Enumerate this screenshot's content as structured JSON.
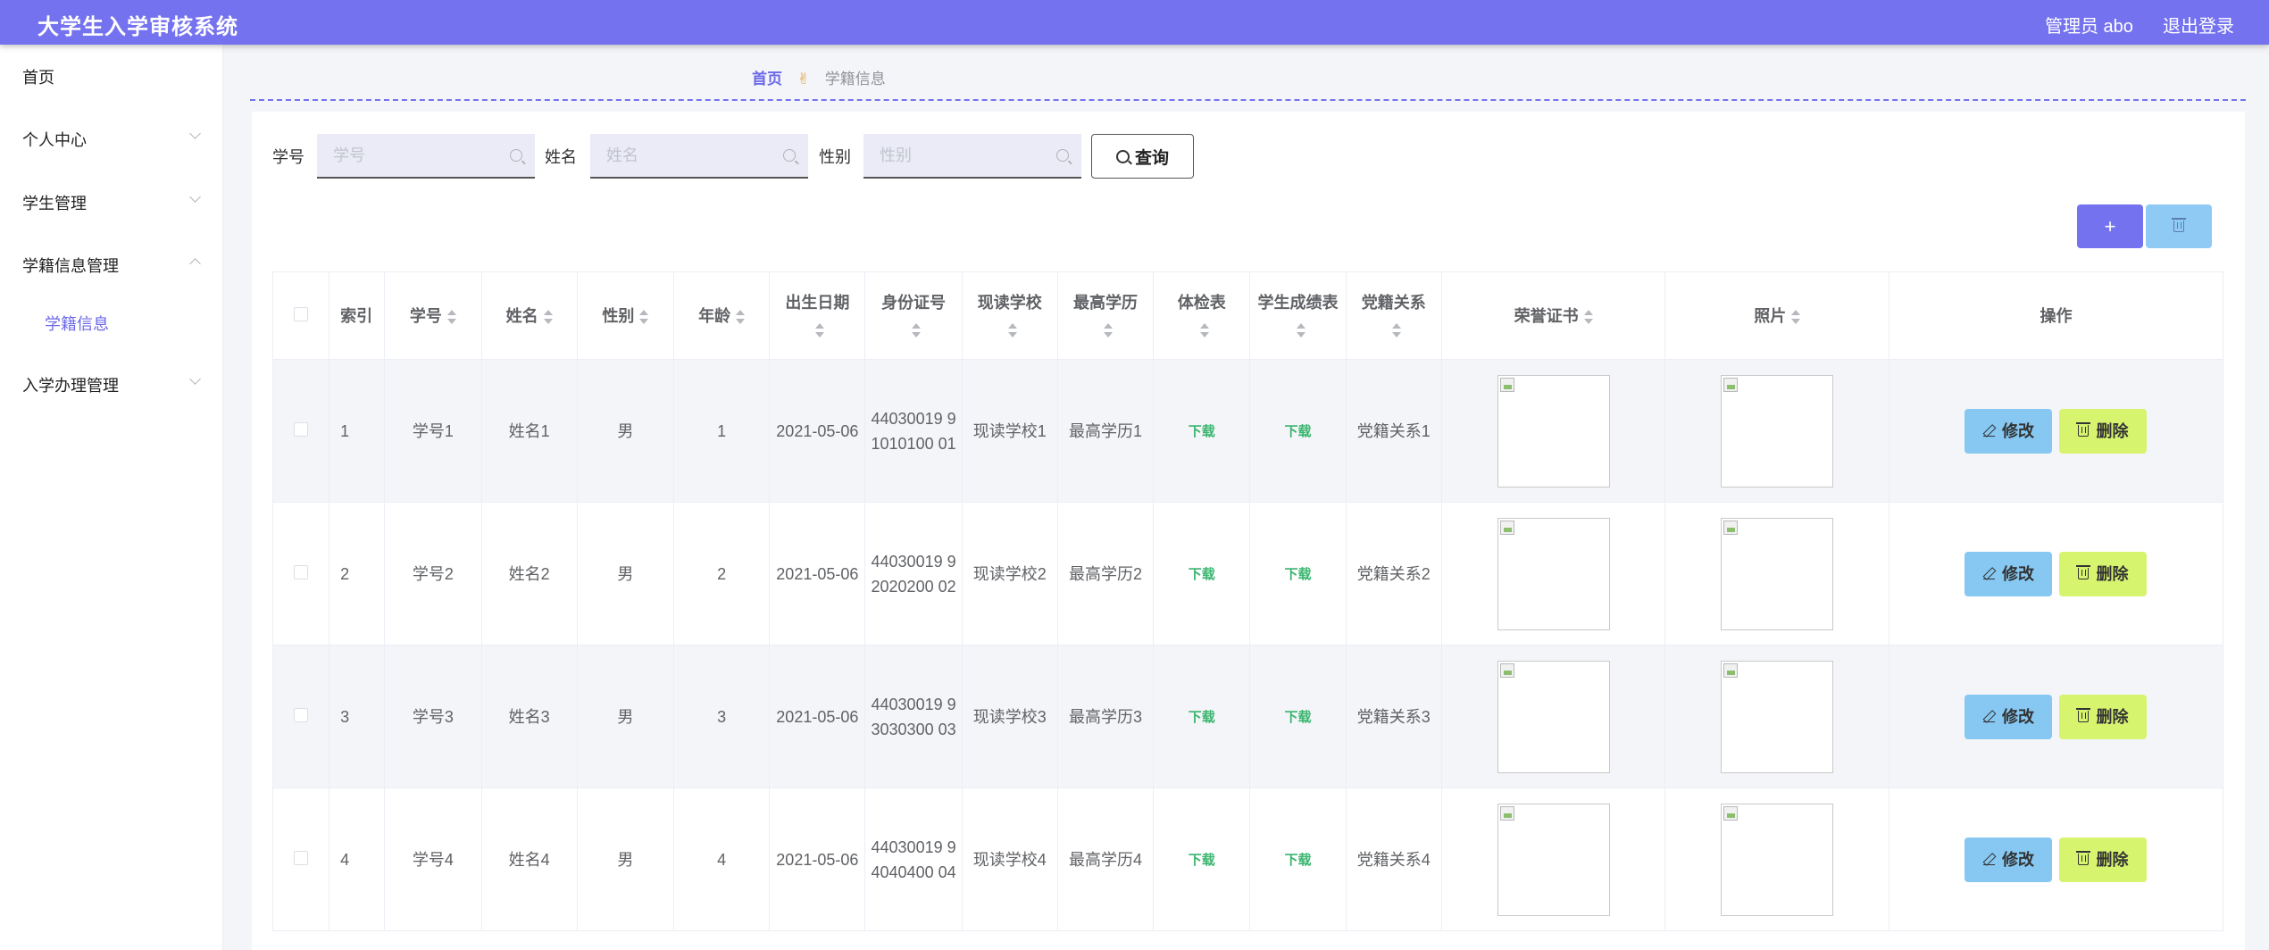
{
  "app": {
    "title": "大学生入学审核系统",
    "user": "管理员 abo",
    "logout": "退出登录"
  },
  "sidebar": {
    "items": [
      {
        "label": "首页"
      },
      {
        "label": "个人中心"
      },
      {
        "label": "学生管理"
      },
      {
        "label": "学籍信息管理"
      },
      {
        "label": "入学办理管理"
      }
    ],
    "sub_items": [
      {
        "label": "学籍信息"
      }
    ]
  },
  "breadcrumb": {
    "home": "首页",
    "sep_icon": "✌",
    "current": "学籍信息"
  },
  "search": {
    "fields": [
      {
        "label": "学号",
        "placeholder": "学号",
        "value": ""
      },
      {
        "label": "姓名",
        "placeholder": "姓名",
        "value": ""
      },
      {
        "label": "性别",
        "placeholder": "性别",
        "value": ""
      }
    ],
    "button": "查询"
  },
  "actions": {
    "add_icon": "+",
    "delete_icon": "trash-icon"
  },
  "table": {
    "columns": [
      "索引",
      "学号",
      "姓名",
      "性别",
      "年龄",
      "出生日期",
      "身份证号",
      "现读学校",
      "最高学历",
      "体检表",
      "学生成绩表",
      "党籍关系",
      "荣誉证书",
      "照片",
      "操作"
    ],
    "download_label": "下载",
    "edit_label": "修改",
    "delete_label": "删除",
    "rows": [
      {
        "index": "1",
        "xuehao": "学号1",
        "name": "姓名1",
        "gender": "男",
        "age": "1",
        "birth": "2021-05-06",
        "idcard": "44030019 91010100 01",
        "school": "现读学校1",
        "edu": "最高学历1",
        "party": "党籍关系1"
      },
      {
        "index": "2",
        "xuehao": "学号2",
        "name": "姓名2",
        "gender": "男",
        "age": "2",
        "birth": "2021-05-06",
        "idcard": "44030019 92020200 02",
        "school": "现读学校2",
        "edu": "最高学历2",
        "party": "党籍关系2"
      },
      {
        "index": "3",
        "xuehao": "学号3",
        "name": "姓名3",
        "gender": "男",
        "age": "3",
        "birth": "2021-05-06",
        "idcard": "44030019 93030300 03",
        "school": "现读学校3",
        "edu": "最高学历3",
        "party": "党籍关系3"
      },
      {
        "index": "4",
        "xuehao": "学号4",
        "name": "姓名4",
        "gender": "男",
        "age": "4",
        "birth": "2021-05-06",
        "idcard": "44030019 94040400 04",
        "school": "现读学校4",
        "edu": "最高学历4",
        "party": "党籍关系4"
      }
    ]
  },
  "colors": {
    "primary": "#7572ef",
    "edit": "#86c8f2",
    "delete": "#d7f46f",
    "download": "#3bb56f"
  }
}
